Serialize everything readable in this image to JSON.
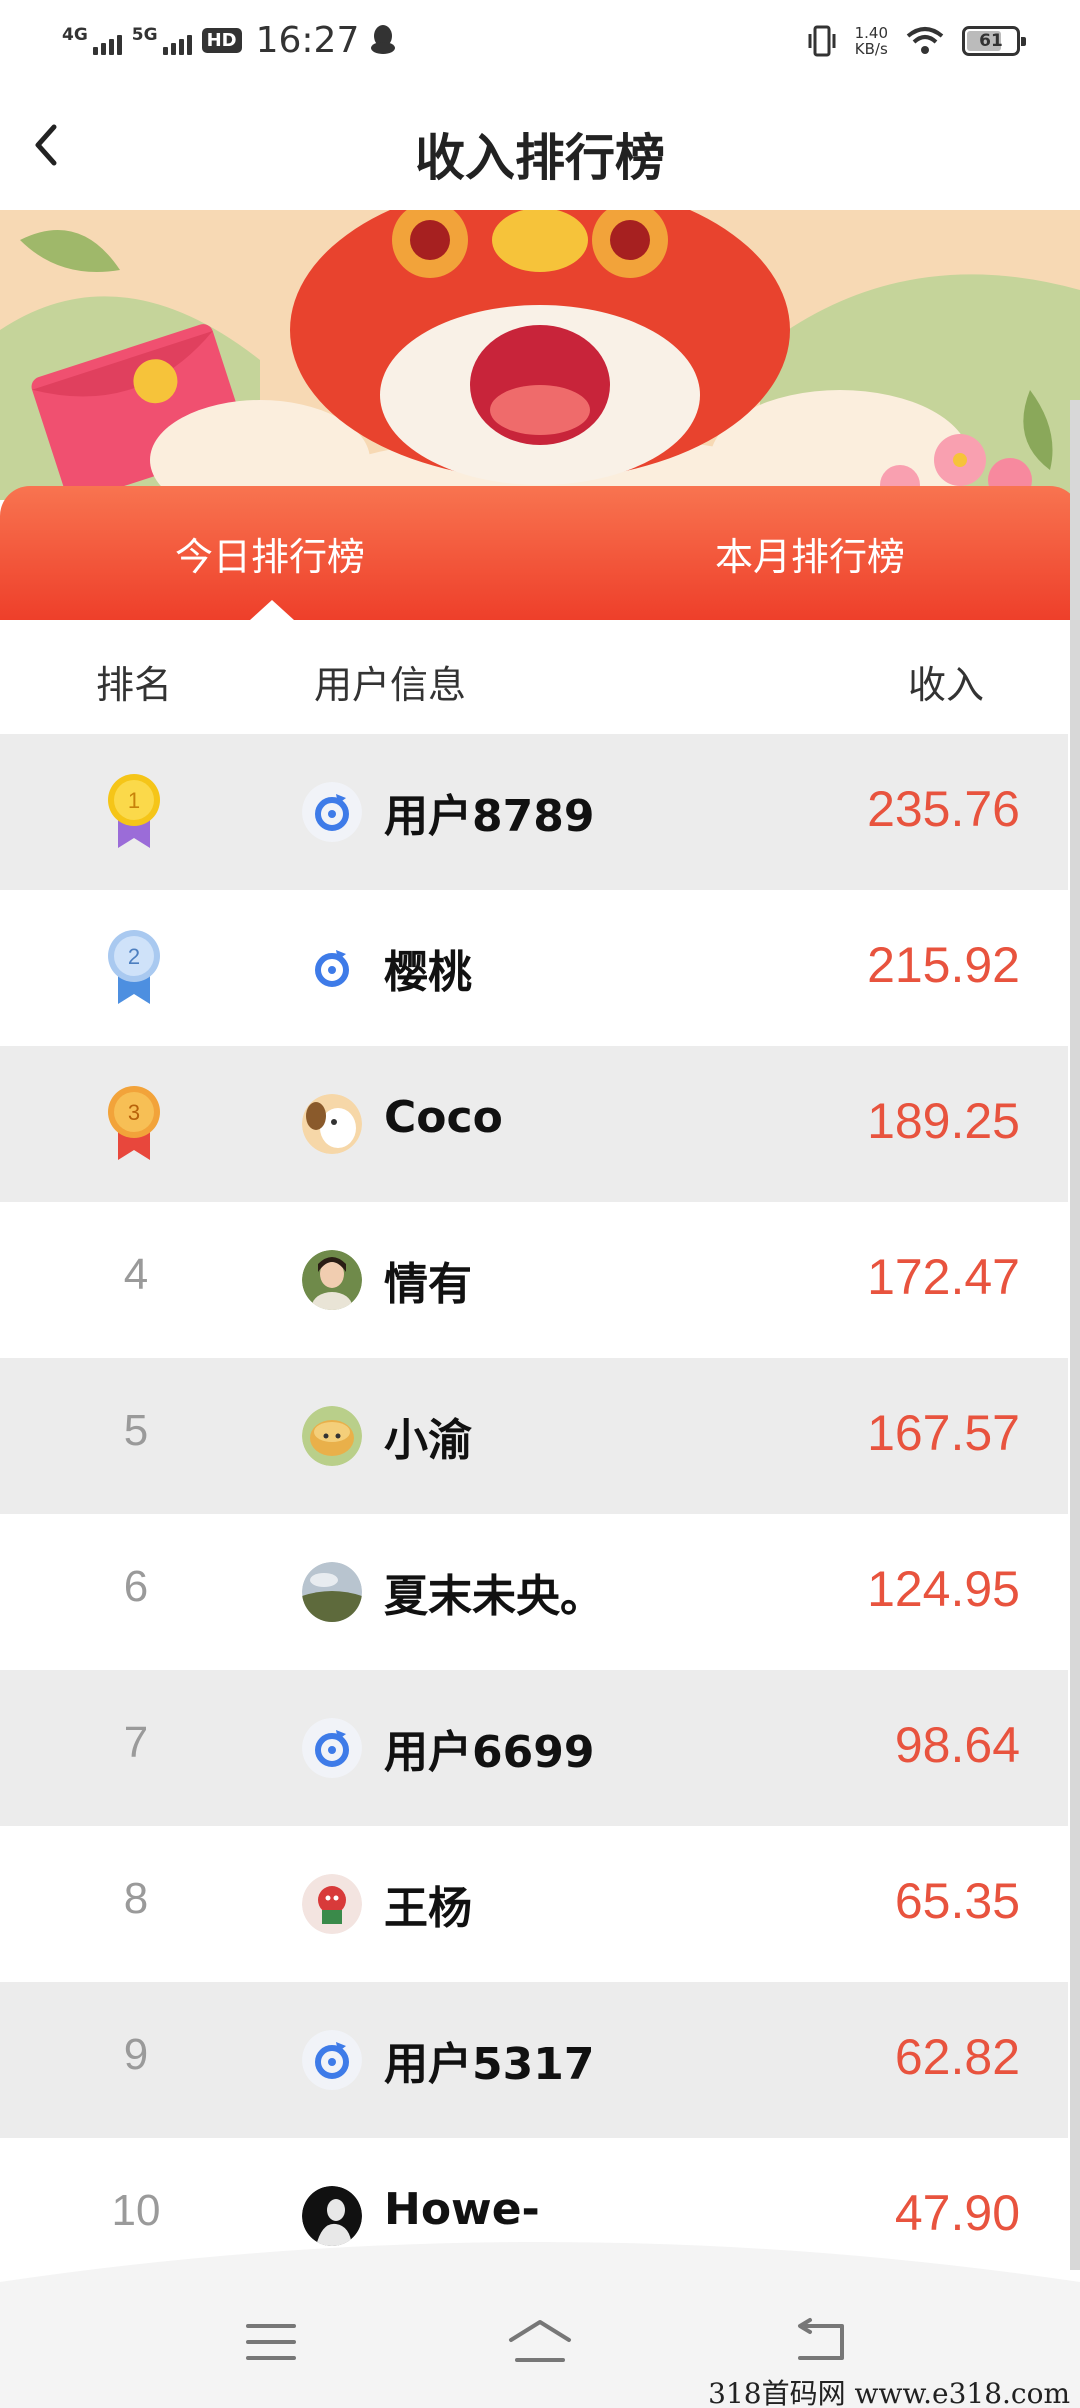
{
  "status_bar": {
    "net1": "4G",
    "net2": "5G",
    "hd": "HD",
    "time": "16:27",
    "speed_value": "1.40",
    "speed_unit": "KB/s",
    "battery": "61"
  },
  "header": {
    "title": "收入排行榜"
  },
  "tabs": [
    {
      "label": "今日排行榜",
      "active": true
    },
    {
      "label": "本月排行榜",
      "active": false
    }
  ],
  "table": {
    "columns": [
      "排名",
      "用户信息",
      "收入"
    ],
    "rows": [
      {
        "rank": "1",
        "name": "用户8789",
        "income": "235.76",
        "avatar": "app-logo"
      },
      {
        "rank": "2",
        "name": "樱桃",
        "income": "215.92",
        "avatar": "app-logo"
      },
      {
        "rank": "3",
        "name": "Coco",
        "income": "189.25",
        "avatar": "dog-photo"
      },
      {
        "rank": "4",
        "name": "情有",
        "income": "172.47",
        "avatar": "portrait-photo"
      },
      {
        "rank": "5",
        "name": "小渝",
        "income": "167.57",
        "avatar": "cartoon-photo"
      },
      {
        "rank": "6",
        "name": "夏末未央。",
        "income": "124.95",
        "avatar": "landscape-photo"
      },
      {
        "rank": "7",
        "name": "用户6699",
        "income": "98.64",
        "avatar": "app-logo"
      },
      {
        "rank": "8",
        "name": "王杨",
        "income": "65.35",
        "avatar": "portrait-photo"
      },
      {
        "rank": "9",
        "name": "用户5317",
        "income": "62.82",
        "avatar": "app-logo"
      },
      {
        "rank": "10",
        "name": "Howe-",
        "income": "47.90",
        "avatar": "silhouette-photo"
      }
    ]
  },
  "medal_colors": {
    "gold": "#f5c518",
    "silver": "#a9c9f0",
    "bronze": "#f2a33a"
  },
  "accent_color": "#e8533e",
  "watermark": "318首码网  www.e318.com"
}
